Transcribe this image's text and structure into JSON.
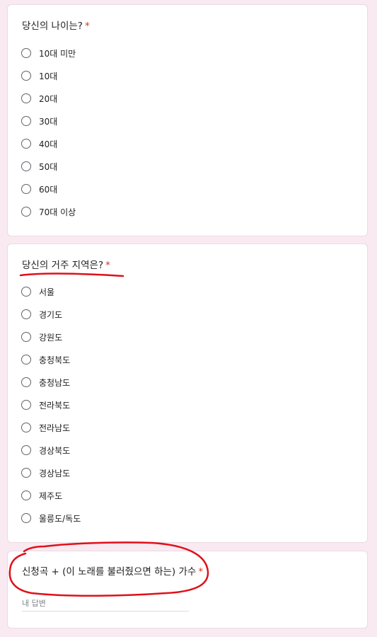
{
  "questions": [
    {
      "title": "당신의 나이는?",
      "required_mark": "*",
      "options": [
        "10대 미만",
        "10대",
        "20대",
        "30대",
        "40대",
        "50대",
        "60대",
        "70대 이상"
      ]
    },
    {
      "title": "당신의 거주 지역은?",
      "required_mark": "*",
      "options": [
        "서울",
        "경기도",
        "강원도",
        "충청북도",
        "충청남도",
        "전라북도",
        "전라남도",
        "경상북도",
        "경상남도",
        "제주도",
        "울릉도/독도"
      ]
    },
    {
      "title": "신청곡 + (이 노래를 불러줬으면 하는) 가수",
      "required_mark": "*",
      "placeholder": "내 답변"
    }
  ],
  "colors": {
    "background": "#f9e9f1",
    "required": "#d93025",
    "annotation": "#e0101a"
  }
}
